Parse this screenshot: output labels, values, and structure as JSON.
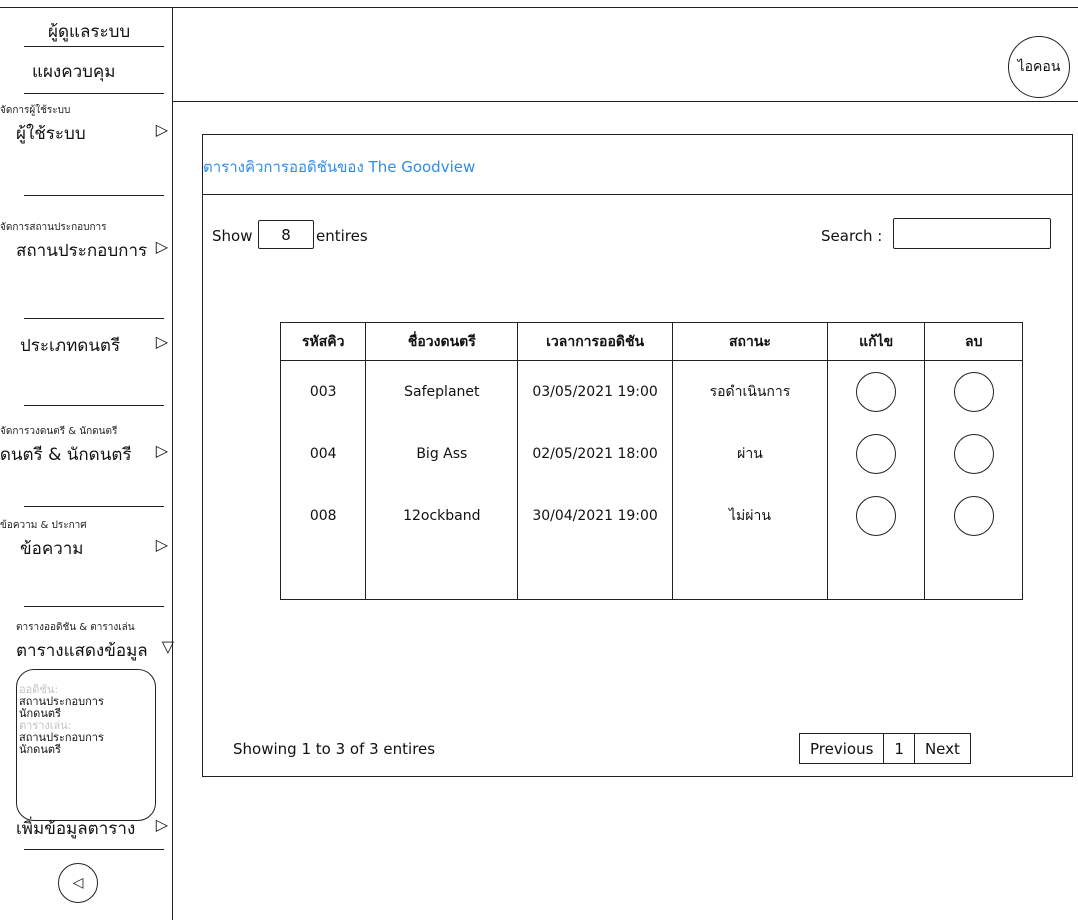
{
  "sidebar": {
    "title": "ผู้ดูแลระบบ",
    "dashboard": "แผงควบคุม",
    "sections": [
      {
        "sub": "จัดการผู้ใช้ระบบ",
        "label": "ผู้ใช้ระบบ"
      },
      {
        "sub": "จัดการสถานประกอบการ",
        "label": "สถานประกอบการ"
      },
      {
        "sub": "",
        "label": "ประเภทดนตรี"
      },
      {
        "sub": "จัดการวงดนตรี & นักดนตรี",
        "label": "วงดนตรี & นักดนตรี"
      },
      {
        "sub": "ข้อความ & ประกาศ",
        "label": "ข้อความ"
      },
      {
        "sub": "ตารางออดิชัน & ตารางเล่น",
        "label": "ตารางแสดงข้อมูล"
      }
    ],
    "submenu": {
      "audition_heading": "ออดิชัน:",
      "audition_items": [
        "สถานประกอบการ",
        "นักดนตรี"
      ],
      "schedule_heading": "ตารางเล่น:",
      "schedule_items": [
        "สถานประกอบการ",
        "นักดนตรี"
      ]
    },
    "add_schedule": "เพิ่มข้อมูลตาราง",
    "arrow_right": "▷",
    "arrow_down": "▽",
    "back_icon": "◁"
  },
  "header": {
    "avatar_label": "ไอคอน"
  },
  "panel": {
    "title": "ตารางคิวการออดิชันของ The Goodview",
    "title_color": "#2f8de4",
    "show_label": "Show",
    "entries_value": "8",
    "entries_label": "entires",
    "search_label": "Search :",
    "search_value": ""
  },
  "table": {
    "headers": [
      "รหัสคิว",
      "ชื่อวงดนตรี",
      "เวลาการออดิชัน",
      "สถานะ",
      "แก้ไข",
      "ลบ"
    ],
    "rows": [
      {
        "id": "003",
        "band": "Safeplanet",
        "time": "03/05/2021 19:00",
        "status": "รอดำเนินการ"
      },
      {
        "id": "004",
        "band": "Big Ass",
        "time": "02/05/2021 18:00",
        "status": "ผ่าน"
      },
      {
        "id": "008",
        "band": "12ockband",
        "time": "30/04/2021 19:00",
        "status": "ไม่ผ่าน"
      }
    ]
  },
  "footer": {
    "summary": "Showing 1 to 3 of 3 entires",
    "previous": "Previous",
    "page": "1",
    "next": "Next"
  }
}
